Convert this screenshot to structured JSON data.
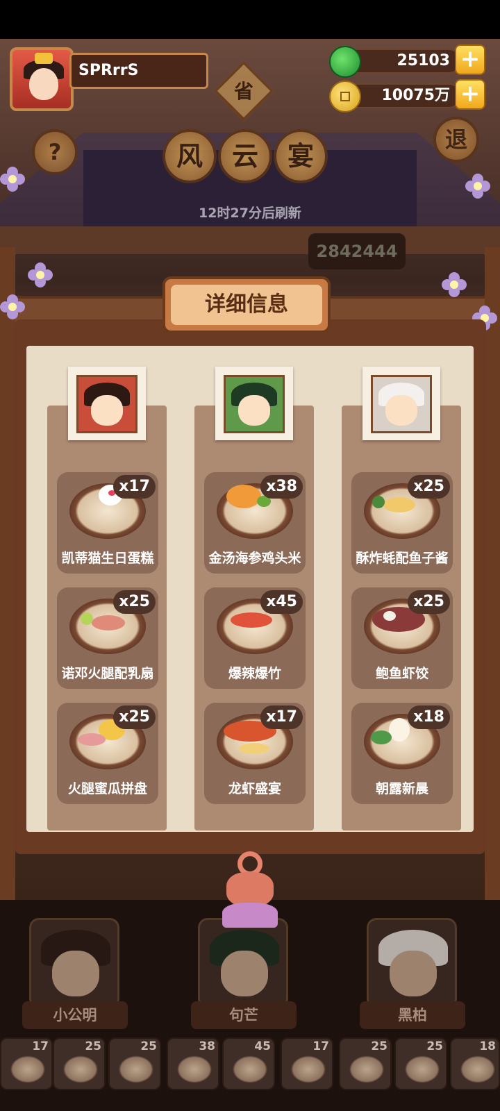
{
  "player": {
    "name": "SPRrrS"
  },
  "currency": {
    "jade": "25103",
    "coins": "10075万"
  },
  "buttons": {
    "help": "?",
    "exit": "退",
    "province": "省"
  },
  "title": {
    "chars": [
      "风",
      "云",
      "宴"
    ]
  },
  "refresh_text": "12时27分后刷新",
  "score": "2842444",
  "panel_title": "详细信息",
  "columns": [
    {
      "chef": "小公明",
      "dishes": [
        {
          "name": "凯蒂猫生日蛋糕",
          "qty": "x17",
          "icon": "hello-kitty-cake-icon"
        },
        {
          "name": "诺邓火腿配乳扇",
          "qty": "x25",
          "icon": "ham-plate-icon"
        },
        {
          "name": "火腿蜜瓜拼盘",
          "qty": "x25",
          "icon": "ham-melon-platter-icon"
        }
      ]
    },
    {
      "chef": "句芒",
      "dishes": [
        {
          "name": "金汤海参鸡头米",
          "qty": "x38",
          "icon": "golden-soup-icon"
        },
        {
          "name": "爆辣爆竹",
          "qty": "x45",
          "icon": "spicy-dish-icon"
        },
        {
          "name": "龙虾盛宴",
          "qty": "x17",
          "icon": "lobster-feast-icon"
        }
      ]
    },
    {
      "chef": "黑柏",
      "dishes": [
        {
          "name": "酥炸蚝配鱼子酱",
          "qty": "x25",
          "icon": "fried-oyster-icon"
        },
        {
          "name": "鲍鱼虾饺",
          "qty": "x25",
          "icon": "abalone-dumpling-icon"
        },
        {
          "name": "朝露新晨",
          "qty": "x18",
          "icon": "morning-dew-icon"
        }
      ]
    }
  ],
  "bottom_slots": [
    "17",
    "25",
    "25",
    "38",
    "45",
    "17",
    "25",
    "25",
    "18"
  ]
}
